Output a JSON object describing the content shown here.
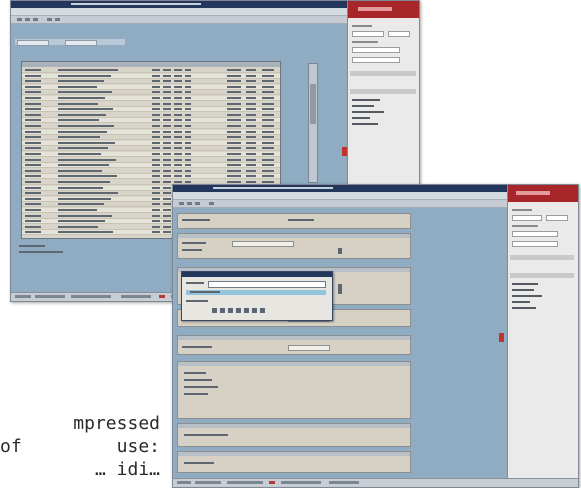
{
  "caption": {
    "line1": "mpressed",
    "line2_a": "of",
    "line2_b": "use:",
    "line3": "… idi…"
  },
  "back_screenshot": {
    "grid_rows": 30,
    "status_indicator_color": "#b23a3a",
    "side_header_color": "#a7262a"
  },
  "front_screenshot": {
    "panels": 8,
    "dialog_selection_color": "#92c4dc"
  },
  "colors": {
    "window_title": "#23375c",
    "workspace": "#8facc2",
    "grid_background": "#d8d4c9",
    "accent_red": "#c2322e"
  }
}
